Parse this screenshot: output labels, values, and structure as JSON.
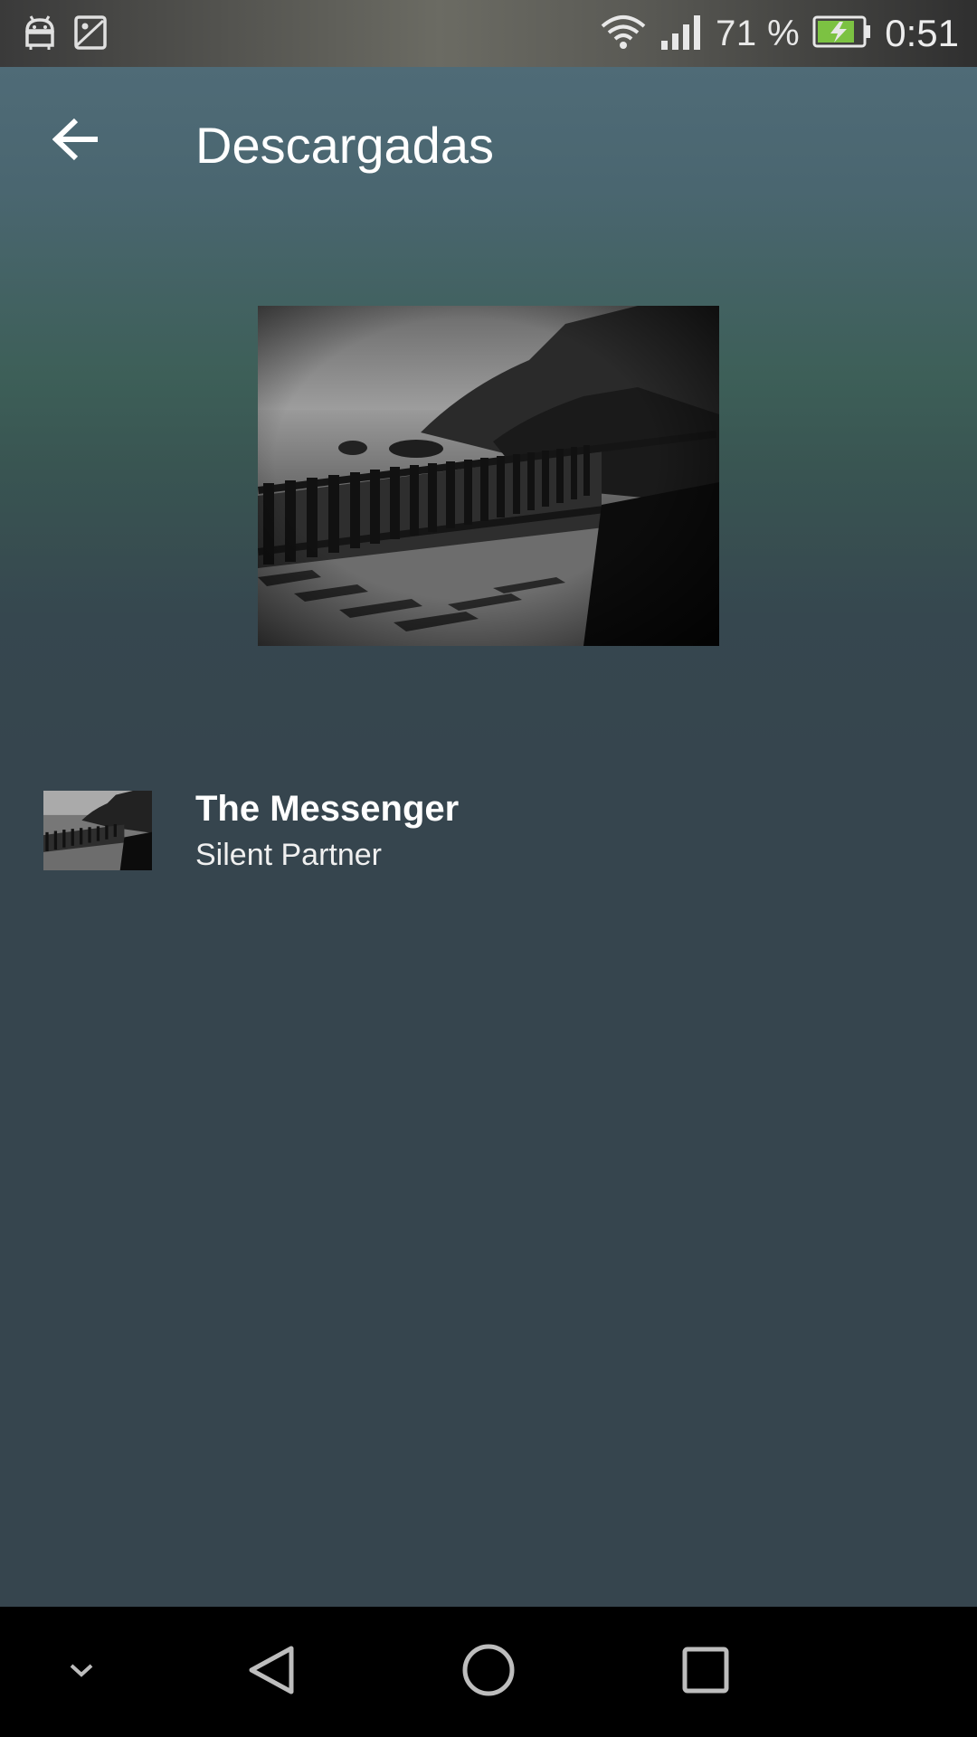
{
  "status_bar": {
    "battery_percent": "71 %",
    "time": "0:51",
    "icons": [
      "android-debug-icon",
      "image-icon",
      "wifi-icon",
      "signal-icon",
      "battery-charging-icon"
    ],
    "battery_fill_color": "#7cc242"
  },
  "header": {
    "back_icon": "arrow-back-icon",
    "title": "Descargadas"
  },
  "album_art": {
    "description_icon": "album-art-image"
  },
  "tracks": [
    {
      "title": "The Messenger",
      "artist": "Silent Partner"
    }
  ],
  "nav_bar": {
    "icons": [
      "chevron-down-icon",
      "back-triangle-icon",
      "home-circle-icon",
      "recents-square-icon"
    ]
  },
  "colors": {
    "background": "#36454e",
    "header_top": "#4f6b77",
    "header_mid": "#3d5f58",
    "nav_bar": "#000000"
  }
}
